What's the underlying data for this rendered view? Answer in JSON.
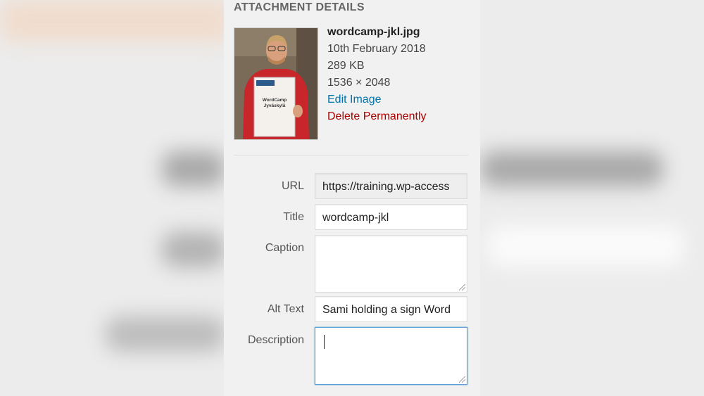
{
  "heading": "ATTACHMENT DETAILS",
  "file": {
    "name": "wordcamp-jkl.jpg",
    "date": "10th February 2018",
    "size": "289 KB",
    "dimensions": "1536 × 2048",
    "edit_label": "Edit Image",
    "delete_label": "Delete Permanently"
  },
  "thumbnail": {
    "sign_text_line1": "WordCamp",
    "sign_text_line2": "Jyväskylä"
  },
  "fields": {
    "url": {
      "label": "URL",
      "value": "https://training.wp-access"
    },
    "title": {
      "label": "Title",
      "value": "wordcamp-jkl"
    },
    "caption": {
      "label": "Caption",
      "value": ""
    },
    "alt_text": {
      "label": "Alt Text",
      "value": "Sami holding a sign Word"
    },
    "description": {
      "label": "Description",
      "value": ""
    }
  },
  "colors": {
    "link": "#0073aa",
    "delete": "#aa0000",
    "focus": "#5b9dd9"
  }
}
